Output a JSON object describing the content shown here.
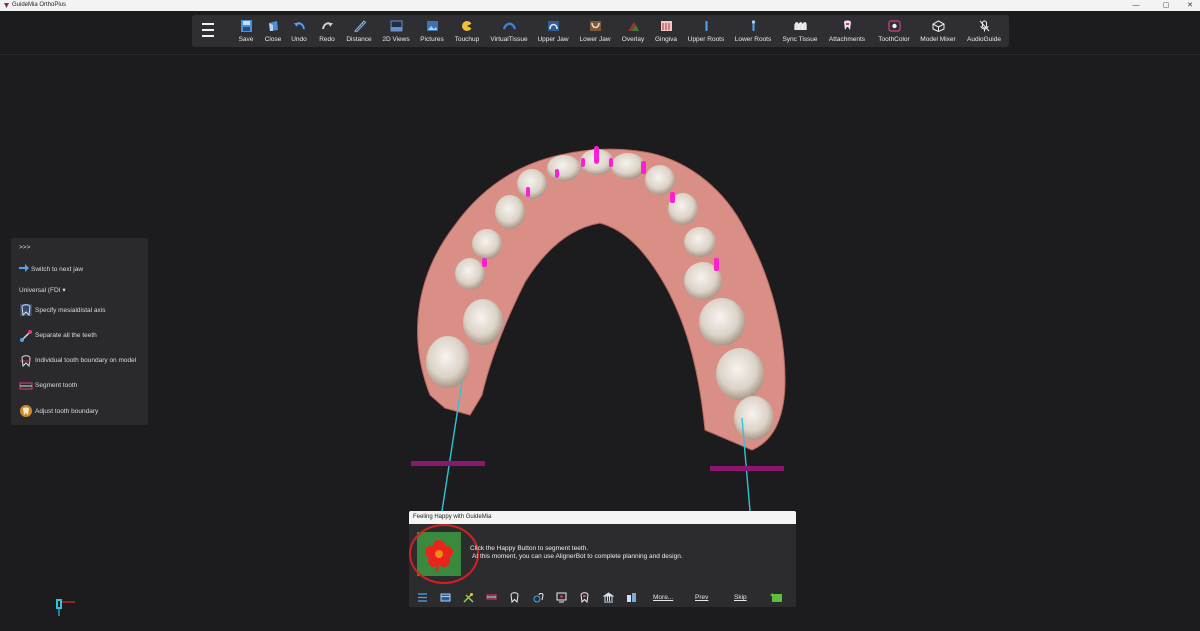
{
  "window": {
    "title": "GuideMia OrthoPlus",
    "controls": {
      "minimize": "—",
      "maximize": "▢",
      "close": "✕"
    }
  },
  "toolbar": {
    "menu_icon": "hamburger-icon",
    "items": [
      {
        "label": "Save",
        "icon": "save-icon"
      },
      {
        "label": "Close",
        "icon": "close-icon"
      },
      {
        "label": "Undo",
        "icon": "undo-icon"
      },
      {
        "label": "Redo",
        "icon": "redo-icon"
      },
      {
        "label": "Distance",
        "icon": "ruler-icon"
      },
      {
        "label": "2D Views",
        "icon": "2d-views-icon"
      },
      {
        "label": "Pictures",
        "icon": "pictures-icon"
      },
      {
        "label": "Touchup",
        "icon": "touchup-icon"
      },
      {
        "label": "VirtualTissue",
        "icon": "virtual-tissue-icon"
      },
      {
        "label": "Upper Jaw",
        "icon": "upper-jaw-icon"
      },
      {
        "label": "Lower Jaw",
        "icon": "lower-jaw-icon"
      },
      {
        "label": "Overlay",
        "icon": "overlay-icon"
      },
      {
        "label": "Gingiva",
        "icon": "gingiva-icon"
      },
      {
        "label": "Upper Roots",
        "icon": "upper-roots-icon"
      },
      {
        "label": "Lower Roots",
        "icon": "lower-roots-icon"
      },
      {
        "label": "Sync Tissue",
        "icon": "sync-tissue-icon"
      },
      {
        "label": "Attachments",
        "icon": "attachments-icon"
      },
      {
        "label": "ToothColor",
        "icon": "tooth-color-icon"
      },
      {
        "label": "Model Mixer",
        "icon": "model-mixer-icon"
      },
      {
        "label": "AudioGuide",
        "icon": "audio-guide-icon"
      }
    ]
  },
  "left_panel": {
    "expand": ">>>",
    "switch_jaw": "Switch to next jaw",
    "numbering": "Universal (FDI",
    "tools": [
      {
        "label": "Specify mesialdistal axis",
        "icon": "mesiodistal-axis-icon"
      },
      {
        "label": "Separate all the teeth",
        "icon": "separate-teeth-icon"
      },
      {
        "label": "Individual tooth boundary on model",
        "icon": "tooth-boundary-icon"
      },
      {
        "label": "Segment tooth",
        "icon": "segment-tooth-icon"
      },
      {
        "label": "Adjust tooth boundary",
        "icon": "adjust-boundary-icon"
      }
    ]
  },
  "dialog": {
    "title": "Feeling Happy with GuideMia",
    "line1": "Click the Happy Button to segment teeth.",
    "line2": "At this moment, you can use AlignerBot to complete planning and design.",
    "more": "More...",
    "prev": "Prev",
    "skip": "Skip",
    "image_icon": "happy-flower-icon"
  },
  "colors": {
    "background": "#1c1c1e",
    "toolbar": "#2f2f33",
    "panel": "#2a2a2d",
    "accent_magenta": "#ff1fd0",
    "marker_purple": "#8a1670",
    "axis_cyan": "#2ec4d8",
    "highlight_red": "#d42020"
  }
}
